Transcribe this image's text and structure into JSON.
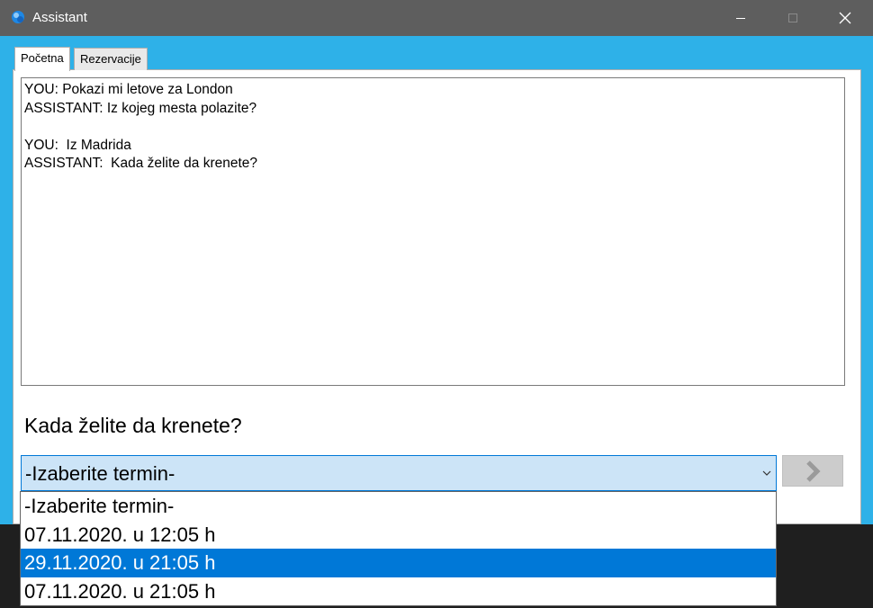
{
  "window": {
    "title": "Assistant"
  },
  "tabs": [
    {
      "label": "Početna",
      "active": true
    },
    {
      "label": "Rezervacije",
      "active": false
    }
  ],
  "chat": {
    "lines": [
      "YOU: Pokazi mi letove za London",
      "ASSISTANT: Iz kojeg mesta polazite?",
      "",
      "YOU:  Iz Madrida",
      "ASSISTANT:  Kada želite da krenete?"
    ]
  },
  "question": "Kada želite da krenete?",
  "combo": {
    "selected_value": "-Izaberite termin-"
  },
  "dropdown": {
    "options": [
      {
        "label": "-Izaberite termin-",
        "highlighted": false
      },
      {
        "label": "07.11.2020. u 12:05 h",
        "highlighted": false
      },
      {
        "label": "29.11.2020. u 21:05 h",
        "highlighted": true
      },
      {
        "label": "07.11.2020. u 21:05 h",
        "highlighted": false
      }
    ]
  },
  "colors": {
    "accent": "#0078d7",
    "window_bg": "#2eb1e8",
    "titlebar": "#5e5e5e"
  },
  "icons": {
    "app": "app-globe-icon",
    "next": "chevron-right-icon",
    "combo": "chevron-down-icon"
  }
}
